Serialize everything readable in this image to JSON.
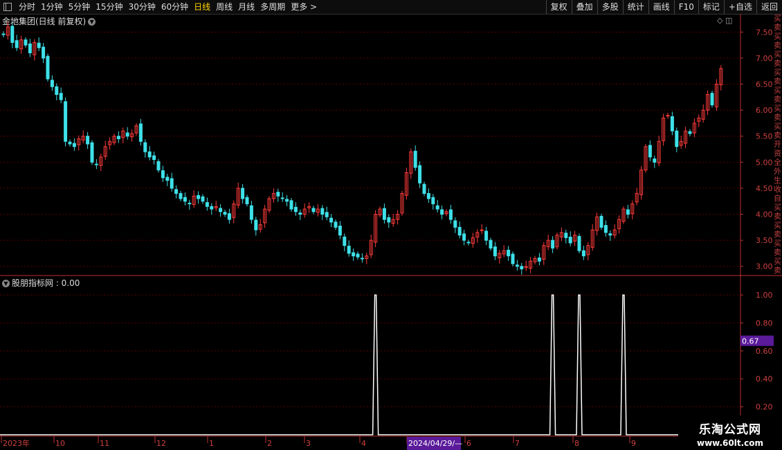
{
  "toolbar": {
    "tabs": [
      "分时",
      "1分钟",
      "5分钟",
      "15分钟",
      "30分钟",
      "60分钟",
      "日线",
      "周线",
      "月线",
      "多周期",
      "更多 >"
    ],
    "active_tab": "日线",
    "right_buttons": [
      "复权",
      "叠加",
      "多股",
      "统计",
      "画线",
      "F10",
      "标记",
      "+自选",
      "返回"
    ]
  },
  "main_chart": {
    "title": "金地集团(日线 前复权)",
    "y_ticks": [
      "7.50",
      "7.00",
      "6.50",
      "6.00",
      "5.50",
      "5.00",
      "4.50",
      "4.00",
      "3.50",
      "3.00"
    ]
  },
  "indicator": {
    "title": "股朋指标网 : 0.00",
    "y_ticks": [
      "1.00",
      "0.80",
      "0.60",
      "0.40",
      "0.20"
    ],
    "cursor_value": "0.67"
  },
  "x_axis": {
    "labels": [
      "2023年",
      "10",
      "11",
      "12",
      "1",
      "2",
      "3",
      "4",
      "2024/04/29/—",
      "6",
      "7",
      "8",
      "9"
    ],
    "highlight": "2024/04/29/—"
  },
  "watermark": {
    "line1": "乐淘公式网",
    "line2": "www.60lt.com"
  },
  "colors": {
    "up": "#ff3b3b",
    "down": "#3ee0e8",
    "signal": "#ffffff",
    "grid": "#5a0000",
    "axis": "#c03030",
    "highlight": "#5a1a9a"
  },
  "chart_data": {
    "type": "candlestick",
    "price_range": [
      2.85,
      7.85
    ],
    "indicator_range": [
      0,
      1.05
    ],
    "closes": [
      7.45,
      7.6,
      7.3,
      7.2,
      7.35,
      7.25,
      7.1,
      7.3,
      7.2,
      7.0,
      6.6,
      6.45,
      6.3,
      6.2,
      5.4,
      5.35,
      5.3,
      5.45,
      5.5,
      5.35,
      5.0,
      4.95,
      5.1,
      5.3,
      5.4,
      5.5,
      5.45,
      5.6,
      5.5,
      5.55,
      5.7,
      5.4,
      5.2,
      5.1,
      5.05,
      4.85,
      4.7,
      4.65,
      4.5,
      4.4,
      4.3,
      4.25,
      4.2,
      4.35,
      4.3,
      4.25,
      4.15,
      4.1,
      4.15,
      4.05,
      4.0,
      3.9,
      4.2,
      4.5,
      4.3,
      4.2,
      3.9,
      3.7,
      3.8,
      4.1,
      4.3,
      4.4,
      4.35,
      4.3,
      4.25,
      4.1,
      4.05,
      4.0,
      4.1,
      4.15,
      4.05,
      4.1,
      4.0,
      3.95,
      3.85,
      3.75,
      3.6,
      3.4,
      3.25,
      3.2,
      3.18,
      3.15,
      3.2,
      3.5,
      4.0,
      4.1,
      3.9,
      3.85,
      3.9,
      4.0,
      4.4,
      4.8,
      5.2,
      4.9,
      4.6,
      4.4,
      4.3,
      4.2,
      4.1,
      4.0,
      4.05,
      3.9,
      3.75,
      3.6,
      3.5,
      3.45,
      3.55,
      3.65,
      3.7,
      3.5,
      3.35,
      3.2,
      3.25,
      3.3,
      3.2,
      3.05,
      3.0,
      2.95,
      3.0,
      3.1,
      3.15,
      3.1,
      3.4,
      3.5,
      3.35,
      3.6,
      3.65,
      3.55,
      3.45,
      3.6,
      3.3,
      3.2,
      3.4,
      3.7,
      3.95,
      3.75,
      3.65,
      3.6,
      3.7,
      3.9,
      4.1,
      4.0,
      4.2,
      4.4,
      4.85,
      5.3,
      5.1,
      5.0,
      5.4,
      5.85,
      5.9,
      5.6,
      5.3,
      5.4,
      5.6,
      5.55,
      5.75,
      5.85,
      6.0,
      6.3,
      6.1,
      6.5,
      6.8
    ],
    "signal_days": [
      84,
      124,
      130,
      140
    ]
  }
}
